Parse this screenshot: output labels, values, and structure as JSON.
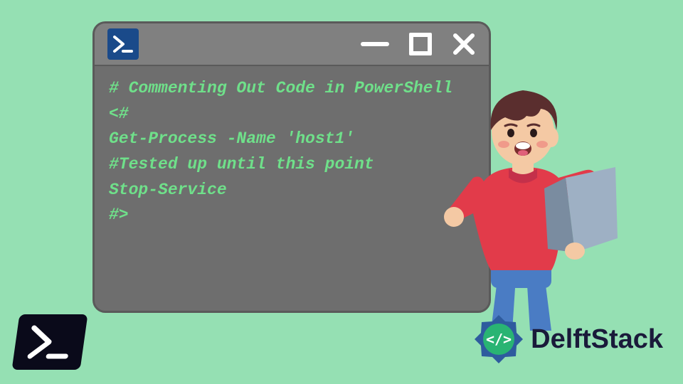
{
  "terminal": {
    "code_lines": [
      "# Commenting Out Code in PowerShell",
      "<#",
      "Get-Process -Name 'host1'",
      "",
      "#Tested up until this point",
      "",
      "Stop-Service",
      "#>"
    ]
  },
  "brand": {
    "name": "DelftStack"
  },
  "icons": {
    "powershell_prompt": ">_",
    "minimize": "minimize",
    "maximize": "maximize",
    "close": "close"
  }
}
